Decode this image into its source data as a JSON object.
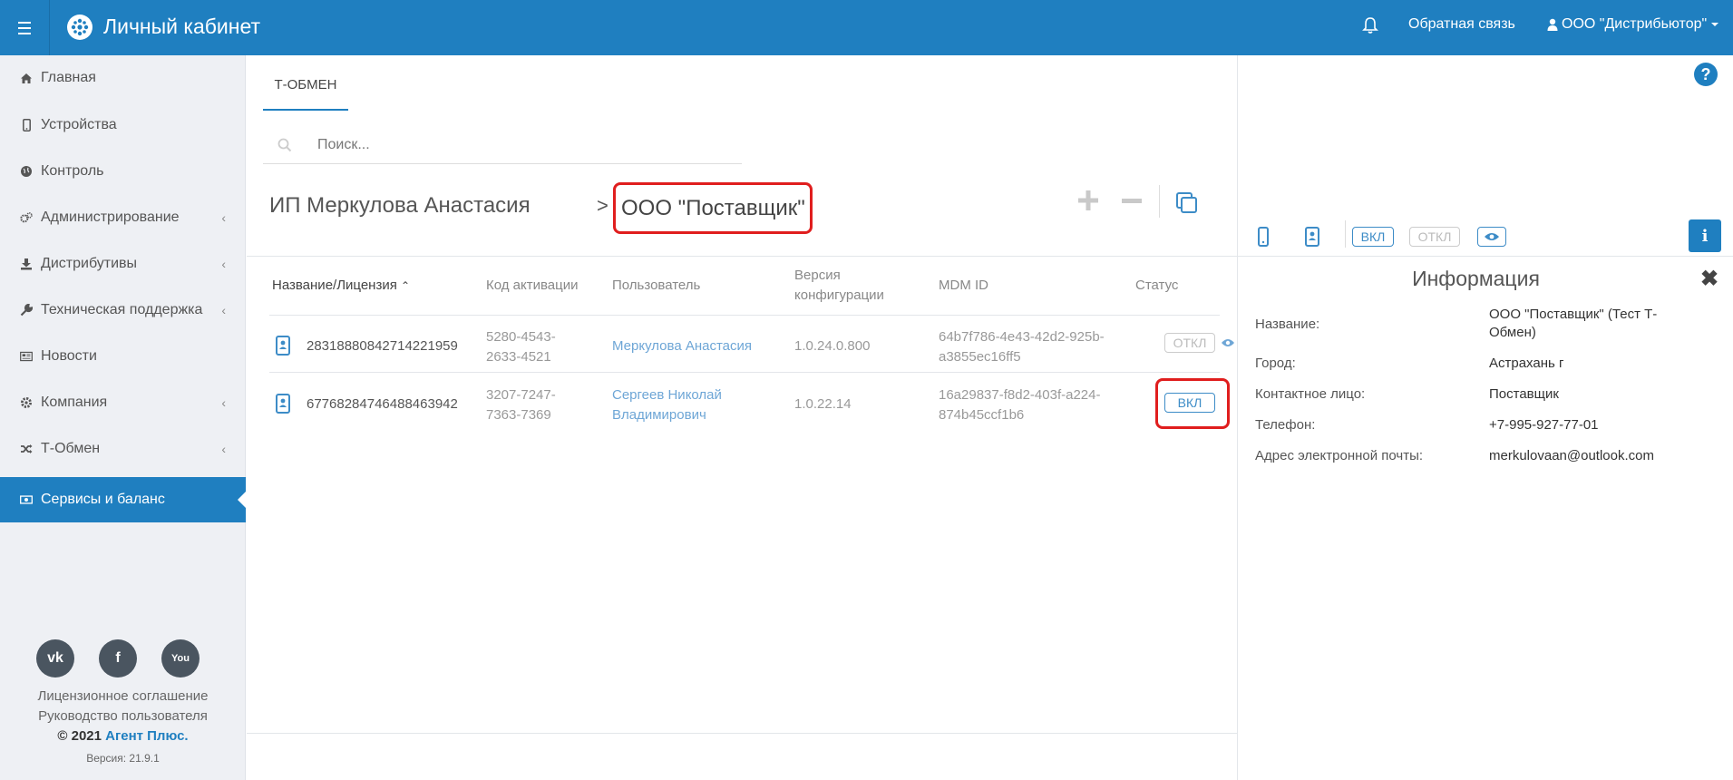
{
  "header": {
    "title": "Личный кабинет",
    "feedback": "Обратная связь",
    "user": "ООО \"Дистрибьютор\"",
    "menu_icon": "hamburger-icon",
    "bell_icon": "bell-icon"
  },
  "sidebar": {
    "items": [
      {
        "label": "Главная",
        "icon": "home-icon"
      },
      {
        "label": "Устройства",
        "icon": "mobile-icon"
      },
      {
        "label": "Контроль",
        "icon": "globe-icon"
      },
      {
        "label": "Администрирование",
        "icon": "gears-icon"
      },
      {
        "label": "Дистрибутивы",
        "icon": "download-icon"
      },
      {
        "label": "Техническая поддержка",
        "icon": "wrench-icon"
      },
      {
        "label": "Новости",
        "icon": "newspaper-icon"
      },
      {
        "label": "Компания",
        "icon": "gear-icon"
      },
      {
        "label": "Т-Обмен",
        "icon": "shuffle-icon"
      },
      {
        "label": "Сервисы и баланс",
        "icon": "money-icon"
      }
    ],
    "footer": {
      "license": "Лицензионное соглашение",
      "guide": "Руководство пользователя",
      "copyright_prefix": "© 2021",
      "copyright_brand": "Агент Плюс.",
      "version": "Версия: 21.9.1",
      "social": [
        "vk-icon",
        "facebook-icon",
        "youtube-icon"
      ]
    }
  },
  "main": {
    "tab": "Т-ОБМЕН",
    "search_placeholder": "Поиск...",
    "breadcrumb": {
      "left": "ИП Меркулова Анастасия",
      "separator": ">",
      "right": "ООО \"Поставщик\""
    },
    "table": {
      "headers": {
        "name": "Название/Лицензия",
        "activation": "Код активации",
        "user": "Пользователь",
        "version_1": "Версия",
        "version_2": "конфигурации",
        "mdm": "MDM ID",
        "status": "Статус"
      },
      "rows": [
        {
          "license": "28318880842714221959",
          "code_1": "5280-4543-",
          "code_2": "2633-4521",
          "user_1": "Меркулова Анастасия",
          "user_2": "",
          "version": "1.0.24.0.800",
          "mdm_1": "64b7f786-4e43-42d2-925b-",
          "mdm_2": "a3855ec16ff5",
          "status": "ОТКЛ"
        },
        {
          "license": "67768284746488463942",
          "code_1": "3207-7247-",
          "code_2": "7363-7369",
          "user_1": "Сергеев Николай",
          "user_2": "Владимирович",
          "version": "1.0.22.14",
          "mdm_1": "16a29837-f8d2-403f-a224-",
          "mdm_2": "874b45ccf1b6",
          "status": "ВКЛ"
        }
      ]
    }
  },
  "right_panel": {
    "badge_on": "ВКЛ",
    "badge_off": "ОТКЛ",
    "title": "Информация",
    "fields": [
      {
        "label": "Название:",
        "value_1": "ООО \"Поставщик\" (Тест Т-",
        "value_2": "Обмен)"
      },
      {
        "label": "Город:",
        "value_1": "Астрахань г",
        "value_2": ""
      },
      {
        "label": "Контактное лицо:",
        "value_1": "Поставщик",
        "value_2": ""
      },
      {
        "label": "Телефон:",
        "value_1": "+7-995-927-77-01",
        "value_2": ""
      },
      {
        "label": "Адрес электронной почты:",
        "value_1": "merkulovaan@outlook.com",
        "value_2": ""
      }
    ]
  },
  "colors": {
    "primary": "#1f7fc0",
    "link": "#6ea6d6",
    "highlight": "#e01e1e"
  }
}
